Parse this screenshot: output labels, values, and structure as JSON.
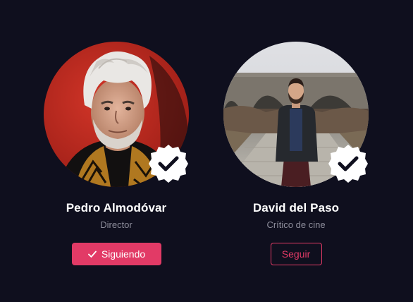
{
  "colors": {
    "background": "#0f0f1e",
    "accent": "#e23a66",
    "name_text": "#ffffff",
    "role_text": "#8e8e9c"
  },
  "profiles": [
    {
      "name": "Pedro Almodóvar",
      "role": "Director",
      "button_label": "Siguiendo",
      "button_state": "following",
      "button_icon": "check-icon",
      "badge_icon": "verified-badge-icon"
    },
    {
      "name": "David del Paso",
      "role": "Crítico de cine",
      "button_label": "Seguir",
      "button_state": "not-following",
      "badge_icon": "verified-badge-icon"
    }
  ]
}
